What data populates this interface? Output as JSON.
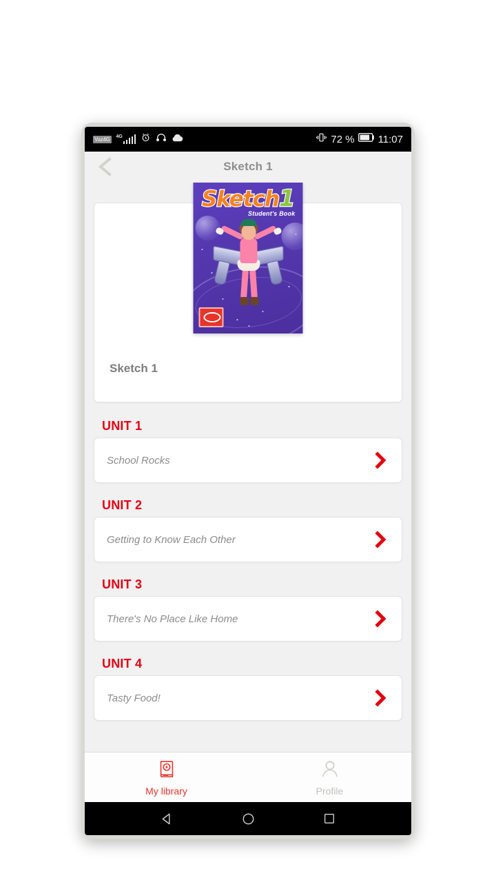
{
  "status_bar": {
    "carrier": "Vaz4G",
    "network_type": "4G",
    "battery_percent": "72 %",
    "time": "11:07",
    "icons": [
      "carrier-badge",
      "signal-bars-icon",
      "alarm-clock-icon",
      "headphones-icon",
      "cloud-icon",
      "vibrate-icon",
      "battery-icon"
    ]
  },
  "header": {
    "title": "Sketch 1",
    "back_icon": "chevron-left-icon"
  },
  "book": {
    "card_title": "Sketch 1",
    "cover_title": "Sketch",
    "cover_number": "1",
    "cover_subtitle": "Student's Book"
  },
  "units": [
    {
      "label": "UNIT 1",
      "name": "School Rocks",
      "arrow_icon": "chevron-right-icon"
    },
    {
      "label": "UNIT 2",
      "name": "Getting to Know Each Other",
      "arrow_icon": "chevron-right-icon"
    },
    {
      "label": "UNIT 3",
      "name": "There's No Place Like Home",
      "arrow_icon": "chevron-right-icon"
    },
    {
      "label": "UNIT 4",
      "name": "Tasty Food!",
      "arrow_icon": "chevron-right-icon"
    }
  ],
  "tab_bar": {
    "tabs": [
      {
        "label": "My library",
        "icon": "book-play-icon",
        "active": true
      },
      {
        "label": "Profile",
        "icon": "person-icon",
        "active": false
      }
    ]
  },
  "nav_bar": {
    "back": "back-triangle-icon",
    "home": "home-circle-icon",
    "recents": "recents-square-icon"
  },
  "colors": {
    "accent_red": "#e60013",
    "tab_red": "#e8342a",
    "muted_gray": "#8c8c8c",
    "page_background": "#f1f1f1",
    "card_background": "#ffffff",
    "cover_purple": "#5437ad",
    "cover_orange": "#f58220",
    "cover_green": "#8cc63f"
  }
}
